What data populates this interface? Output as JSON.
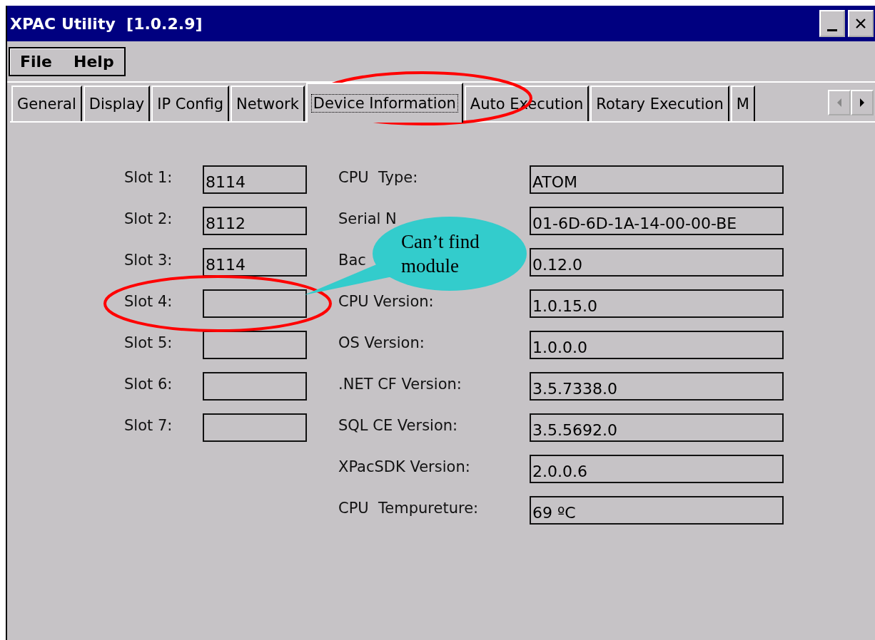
{
  "window": {
    "title": "XPAC Utility  [1.0.2.9]"
  },
  "menu": [
    "File",
    "Help"
  ],
  "tabs": [
    {
      "label": "General",
      "selected": false
    },
    {
      "label": "Display",
      "selected": false
    },
    {
      "label": "IP Config",
      "selected": false
    },
    {
      "label": "Network",
      "selected": false
    },
    {
      "label": "Device Information",
      "selected": true
    },
    {
      "label": "Auto Execution",
      "selected": false
    },
    {
      "label": "Rotary Execution",
      "selected": false
    },
    {
      "label": "M",
      "selected": false
    }
  ],
  "slots": [
    {
      "label": "Slot 1:",
      "value": "8114"
    },
    {
      "label": "Slot 2:",
      "value": "8112"
    },
    {
      "label": "Slot 3:",
      "value": "8114"
    },
    {
      "label": "Slot 4:"
    },
    {
      "label": "Slot 5:"
    },
    {
      "label": "Slot 6:"
    },
    {
      "label": "Slot 7:"
    }
  ],
  "info": [
    {
      "label": "CPU  Type:",
      "value": "ATOM"
    },
    {
      "label": "Serial N",
      "value": "01-6D-6D-1A-14-00-00-BE"
    },
    {
      "label": "Bac",
      "value": "0.12.0"
    },
    {
      "label": "CPU Version:",
      "value": "1.0.15.0"
    },
    {
      "label": "OS Version:",
      "value": "1.0.0.0"
    },
    {
      "label": ".NET CF Version:",
      "value": "3.5.7338.0"
    },
    {
      "label": "SQL CE Version:",
      "value": "3.5.5692.0"
    },
    {
      "label": "XPacSDK Version:",
      "value": "2.0.0.6"
    },
    {
      "label": "CPU  Tempureture:",
      "value": "69 ºC"
    }
  ],
  "callout": {
    "text": "Can’t find module"
  }
}
